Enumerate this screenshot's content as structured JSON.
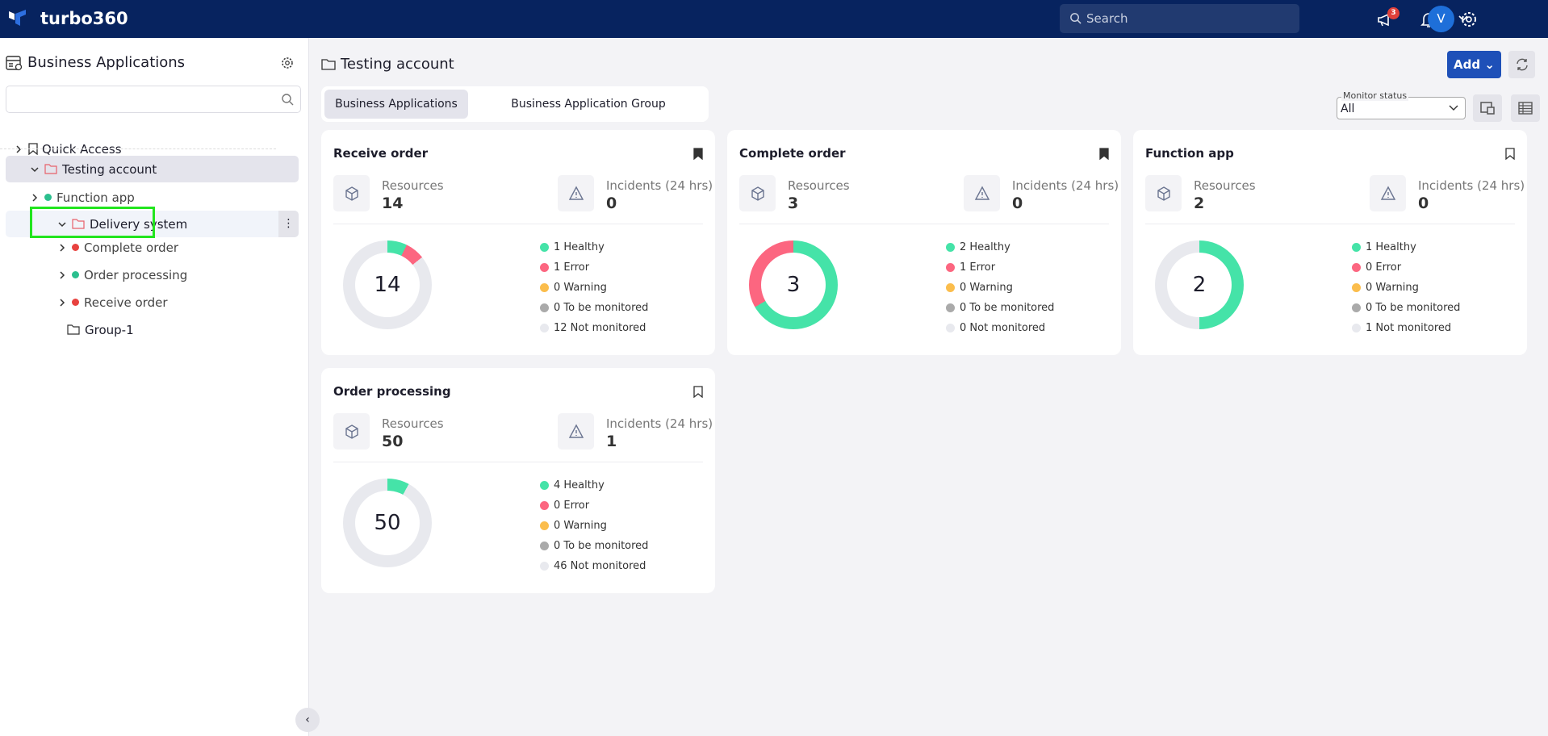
{
  "header": {
    "brand": "turbo360",
    "search_placeholder": "Search",
    "notification_count": "3",
    "avatar_initial": "V",
    "bg_color": "#07235f"
  },
  "sidebar": {
    "title": "Business Applications",
    "search_value": "",
    "tree": [
      {
        "label": "Quick Access",
        "type": "bookmark",
        "level": 0,
        "expanded": false
      },
      {
        "label": "Testing account",
        "type": "folder",
        "level": 0,
        "expanded": true,
        "selected": true
      },
      {
        "label": "Function app",
        "type": "app",
        "status": "healthy",
        "level": 1
      },
      {
        "label": "Delivery system",
        "type": "folder",
        "level": 1,
        "expanded": true,
        "highlighted": true
      },
      {
        "label": "Complete order",
        "type": "app",
        "status": "error",
        "level": 2
      },
      {
        "label": "Order processing",
        "type": "app",
        "status": "healthy",
        "level": 2
      },
      {
        "label": "Receive order",
        "type": "app",
        "status": "error",
        "level": 2
      },
      {
        "label": "Group-1",
        "type": "folder-plain",
        "level": 2
      }
    ]
  },
  "main": {
    "title": "Testing account",
    "tabs": [
      {
        "label": "Business Applications",
        "active": true
      },
      {
        "label": "Business Application Group",
        "active": false
      }
    ],
    "add_label": "Add",
    "monitor_status_label": "Monitor status",
    "monitor_status_value": "All",
    "stat_labels": {
      "resources": "Resources",
      "incidents": "Incidents (24 hrs)"
    },
    "cards": [
      {
        "title": "Receive order",
        "bookmarked": true,
        "resources": "14",
        "incidents": "0",
        "total": "14",
        "healthy": 1,
        "error": 1,
        "warning": 0,
        "to_be_monitored": 0,
        "not_monitored": 12,
        "legend": [
          "1 Healthy",
          "1 Error",
          "0 Warning",
          "0 To be monitored",
          "12 Not monitored"
        ]
      },
      {
        "title": "Complete order",
        "bookmarked": true,
        "resources": "3",
        "incidents": "0",
        "total": "3",
        "healthy": 2,
        "error": 1,
        "warning": 0,
        "to_be_monitored": 0,
        "not_monitored": 0,
        "legend": [
          "2 Healthy",
          "1 Error",
          "0 Warning",
          "0 To be monitored",
          "0 Not monitored"
        ]
      },
      {
        "title": "Function app",
        "bookmarked": false,
        "resources": "2",
        "incidents": "0",
        "total": "2",
        "healthy": 1,
        "error": 0,
        "warning": 0,
        "to_be_monitored": 0,
        "not_monitored": 1,
        "legend": [
          "1 Healthy",
          "0 Error",
          "0 Warning",
          "0 To be monitored",
          "1 Not monitored"
        ]
      },
      {
        "title": "Order processing",
        "bookmarked": false,
        "resources": "50",
        "incidents": "1",
        "total": "50",
        "healthy": 4,
        "error": 0,
        "warning": 0,
        "to_be_monitored": 0,
        "not_monitored": 46,
        "legend": [
          "4 Healthy",
          "0 Error",
          "0 Warning",
          "0 To be monitored",
          "46 Not monitored"
        ]
      }
    ]
  },
  "status_colors": {
    "healthy": "#45e3a8",
    "error": "#fc6680",
    "warning": "#fbbd4c",
    "to_be_monitored": "#aaaaaa",
    "not_monitored": "#e8e9ee",
    "tree_healthy": "#2bbf8e",
    "tree_error": "#e8423f"
  }
}
